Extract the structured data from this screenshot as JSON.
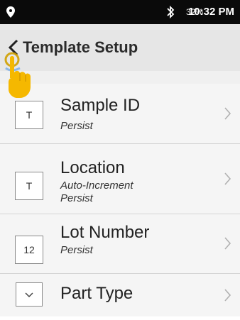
{
  "status_bar": {
    "battery": "32%",
    "time": "10:32 PM",
    "icons": [
      "location-pin-icon",
      "bluetooth-icon"
    ]
  },
  "header": {
    "title": "Template Setup",
    "back_icon": "back-chevron-icon"
  },
  "fields": [
    {
      "type_icon": "T",
      "label": "Sample ID",
      "sub": [
        "Persist"
      ]
    },
    {
      "type_icon": "T",
      "label": "Location",
      "sub": [
        "Auto-Increment",
        "Persist"
      ]
    },
    {
      "type_icon": "12",
      "label": "Lot Number",
      "sub": [
        "Persist"
      ]
    },
    {
      "type_icon": "dropdown-icon",
      "label": "Part Type",
      "sub": []
    }
  ],
  "colors": {
    "status_bar_bg": "#0a0a0a",
    "header_bg": "#e6e6e6",
    "row_bg": "#f5f5f5",
    "hand_cursor": "#f5b800"
  }
}
